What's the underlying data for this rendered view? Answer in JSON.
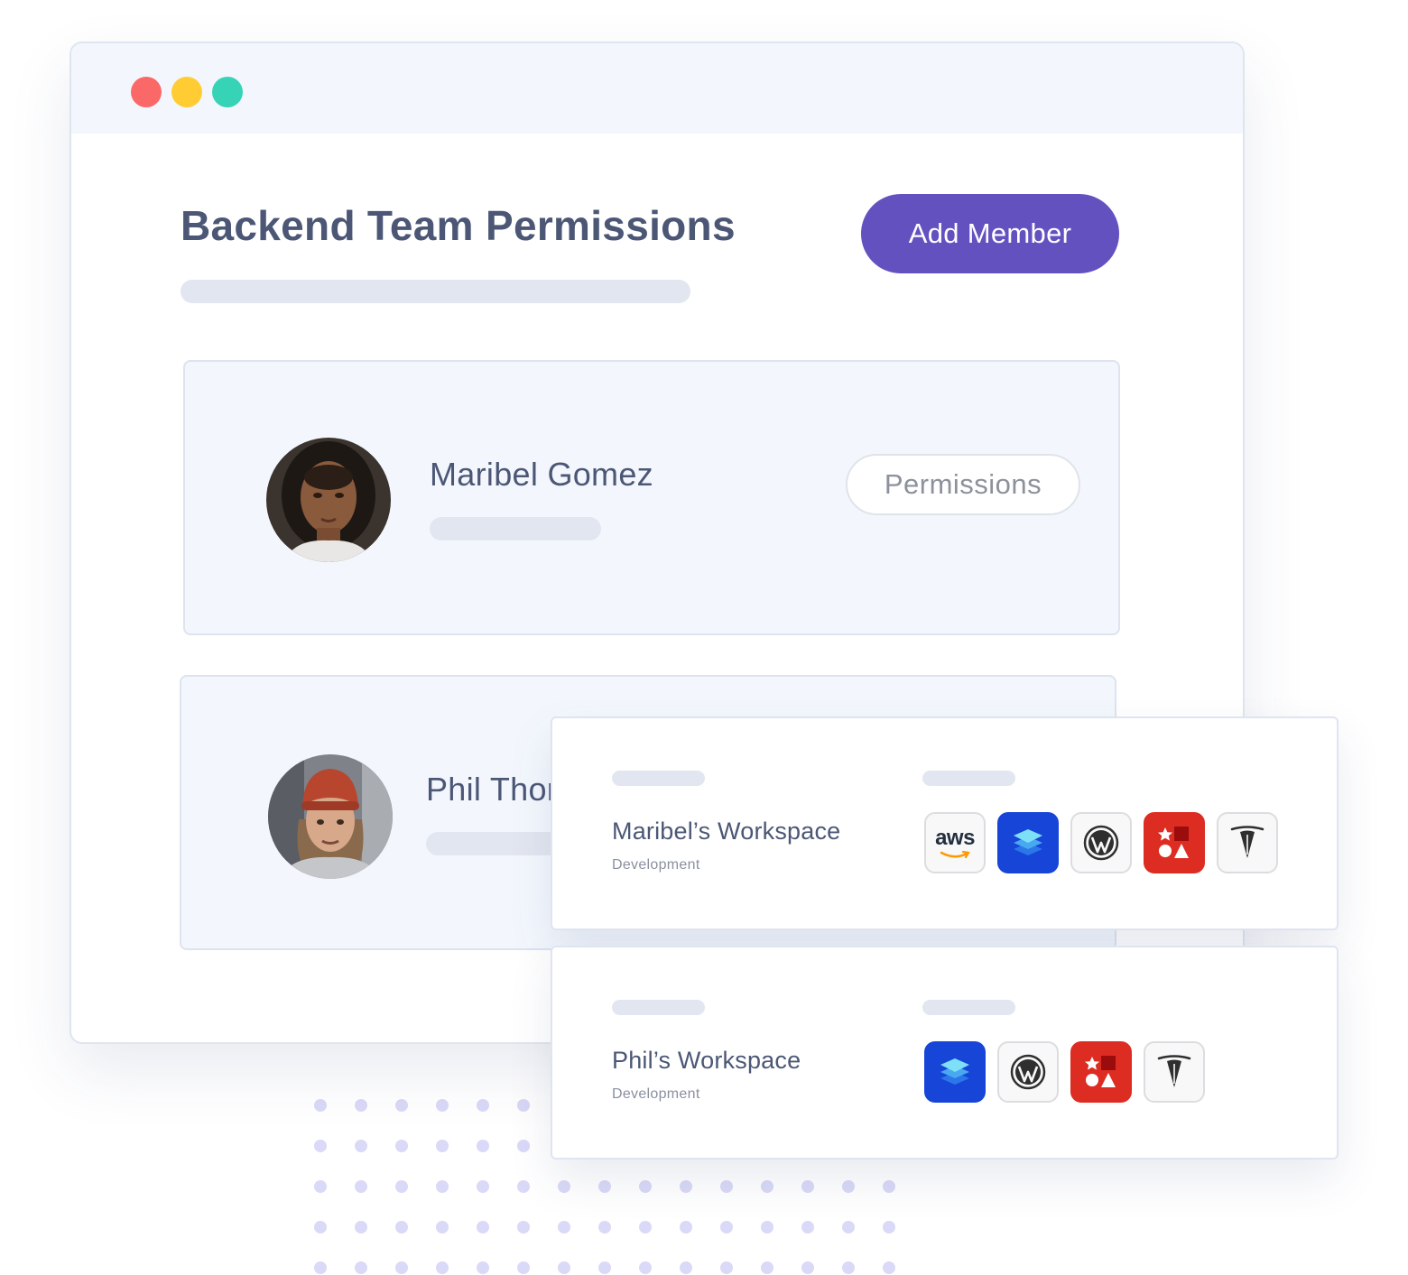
{
  "window": {
    "traffic_lights": [
      {
        "name": "close",
        "color": "#fb6868"
      },
      {
        "name": "minimize",
        "color": "#ffcc33"
      },
      {
        "name": "maximize",
        "color": "#36d3b6"
      }
    ]
  },
  "header": {
    "title": "Backend Team Permissions",
    "add_member_label": "Add Member"
  },
  "members": [
    {
      "name": "Maribel Gomez",
      "button_label": "Permissions",
      "avatar": "person-photo-woman"
    },
    {
      "name": "Phil Thor",
      "avatar": "person-photo-man-beanie"
    }
  ],
  "workspaces": [
    {
      "name": "Maribel’s Workspace",
      "environment": "Development",
      "apps": [
        "aws-icon",
        "layers-icon",
        "wordpress-icon",
        "shapes-icon",
        "cockroach-icon"
      ]
    },
    {
      "name": "Phil’s Workspace",
      "environment": "Development",
      "apps": [
        "layers-icon",
        "wordpress-icon",
        "shapes-icon",
        "cockroach-icon"
      ]
    }
  ],
  "aws_label": "aws",
  "colors": {
    "accent": "#6451c0",
    "card_bg": "#f3f7fd",
    "text": "#4b5775",
    "app_blue": "#1645d8",
    "app_red": "#dd2c22"
  }
}
